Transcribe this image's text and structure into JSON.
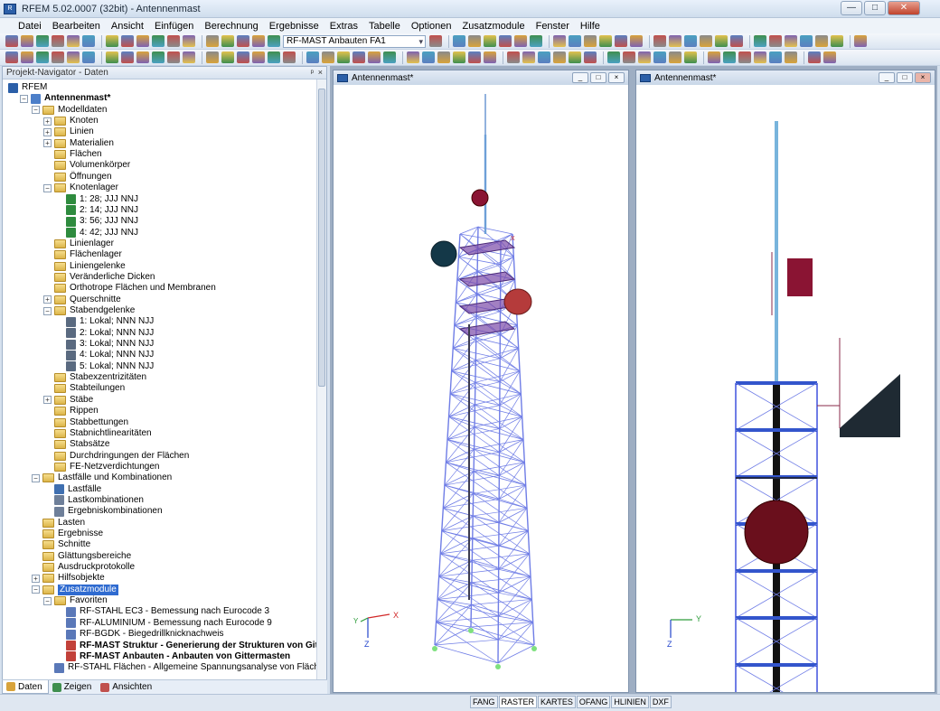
{
  "window": {
    "title": "RFEM 5.02.0007 (32bit) - Antennenmast",
    "min": "—",
    "max": "□",
    "close": "✕"
  },
  "menu": [
    "Datei",
    "Bearbeiten",
    "Ansicht",
    "Einfügen",
    "Berechnung",
    "Ergebnisse",
    "Extras",
    "Tabelle",
    "Optionen",
    "Zusatzmodule",
    "Fenster",
    "Hilfe"
  ],
  "toolbar": {
    "module_combo": "RF-MAST Anbauten FA1"
  },
  "navigator": {
    "title": "Projekt-Navigator - Daten",
    "pin": "ᵖ",
    "close": "×",
    "items": [
      {
        "t": "RFEM",
        "l": 0,
        "k": "root"
      },
      {
        "t": "Antennenmast*",
        "l": 1,
        "k": "proj",
        "b": true,
        "e": "-"
      },
      {
        "t": "Modelldaten",
        "l": 2,
        "k": "f",
        "e": "-"
      },
      {
        "t": "Knoten",
        "l": 3,
        "k": "f",
        "e": "+"
      },
      {
        "t": "Linien",
        "l": 3,
        "k": "f",
        "e": "+"
      },
      {
        "t": "Materialien",
        "l": 3,
        "k": "f",
        "e": "+"
      },
      {
        "t": "Flächen",
        "l": 3,
        "k": "f"
      },
      {
        "t": "Volumenkörper",
        "l": 3,
        "k": "f"
      },
      {
        "t": "Öffnungen",
        "l": 3,
        "k": "f"
      },
      {
        "t": "Knotenlager",
        "l": 3,
        "k": "f",
        "e": "-"
      },
      {
        "t": "1: 28; JJJ NNJ",
        "l": 4,
        "k": "sup"
      },
      {
        "t": "2: 14; JJJ NNJ",
        "l": 4,
        "k": "sup"
      },
      {
        "t": "3: 56; JJJ NNJ",
        "l": 4,
        "k": "sup"
      },
      {
        "t": "4: 42; JJJ NNJ",
        "l": 4,
        "k": "sup"
      },
      {
        "t": "Linienlager",
        "l": 3,
        "k": "f"
      },
      {
        "t": "Flächenlager",
        "l": 3,
        "k": "f"
      },
      {
        "t": "Liniengelenke",
        "l": 3,
        "k": "f"
      },
      {
        "t": "Veränderliche Dicken",
        "l": 3,
        "k": "f"
      },
      {
        "t": "Orthotrope Flächen und Membranen",
        "l": 3,
        "k": "f"
      },
      {
        "t": "Querschnitte",
        "l": 3,
        "k": "f",
        "e": "+"
      },
      {
        "t": "Stabendgelenke",
        "l": 3,
        "k": "f",
        "e": "-"
      },
      {
        "t": "1: Lokal; NNN NJJ",
        "l": 4,
        "k": "hinge"
      },
      {
        "t": "2: Lokal; NNN NJJ",
        "l": 4,
        "k": "hinge"
      },
      {
        "t": "3: Lokal; NNN NJJ",
        "l": 4,
        "k": "hinge"
      },
      {
        "t": "4: Lokal; NNN NJJ",
        "l": 4,
        "k": "hinge"
      },
      {
        "t": "5: Lokal; NNN NJJ",
        "l": 4,
        "k": "hinge"
      },
      {
        "t": "Stabexzentrizitäten",
        "l": 3,
        "k": "f"
      },
      {
        "t": "Stabteilungen",
        "l": 3,
        "k": "f"
      },
      {
        "t": "Stäbe",
        "l": 3,
        "k": "f",
        "e": "+"
      },
      {
        "t": "Rippen",
        "l": 3,
        "k": "f"
      },
      {
        "t": "Stabbettungen",
        "l": 3,
        "k": "f"
      },
      {
        "t": "Stabnichtlinearitäten",
        "l": 3,
        "k": "f"
      },
      {
        "t": "Stabsätze",
        "l": 3,
        "k": "f"
      },
      {
        "t": "Durchdringungen der Flächen",
        "l": 3,
        "k": "f"
      },
      {
        "t": "FE-Netzverdichtungen",
        "l": 3,
        "k": "f"
      },
      {
        "t": "Lastfälle und Kombinationen",
        "l": 2,
        "k": "f",
        "e": "-"
      },
      {
        "t": "Lastfälle",
        "l": 3,
        "k": "lf"
      },
      {
        "t": "Lastkombinationen",
        "l": 3,
        "k": "lk"
      },
      {
        "t": "Ergebniskombinationen",
        "l": 3,
        "k": "lk"
      },
      {
        "t": "Lasten",
        "l": 2,
        "k": "f"
      },
      {
        "t": "Ergebnisse",
        "l": 2,
        "k": "f"
      },
      {
        "t": "Schnitte",
        "l": 2,
        "k": "f"
      },
      {
        "t": "Glättungsbereiche",
        "l": 2,
        "k": "f"
      },
      {
        "t": "Ausdruckprotokolle",
        "l": 2,
        "k": "f"
      },
      {
        "t": "Hilfsobjekte",
        "l": 2,
        "k": "f",
        "e": "+"
      },
      {
        "t": "Zusatzmodule",
        "l": 2,
        "k": "f",
        "e": "-",
        "s": true
      },
      {
        "t": "Favoriten",
        "l": 3,
        "k": "f",
        "e": "-"
      },
      {
        "t": "RF-STAHL EC3 - Bemessung nach Eurocode 3",
        "l": 4,
        "k": "mod"
      },
      {
        "t": "RF-ALUMINIUM - Bemessung nach Eurocode 9",
        "l": 4,
        "k": "mod"
      },
      {
        "t": "RF-BGDK - Biegedrillknicknachweis",
        "l": 4,
        "k": "mod"
      },
      {
        "t": "RF-MAST Struktur - Generierung der Strukturen von Gittermasten",
        "l": 4,
        "k": "modr",
        "b": true
      },
      {
        "t": "RF-MAST Anbauten - Anbauten von Gittermasten",
        "l": 4,
        "k": "modr",
        "b": true
      },
      {
        "t": "RF-STAHL Flächen - Allgemeine Spannungsanalyse von Flächen",
        "l": 3,
        "k": "mod"
      }
    ]
  },
  "navtabs": [
    "Daten",
    "Zeigen",
    "Ansichten"
  ],
  "views": [
    {
      "title": "Antennenmast*",
      "axes": {
        "x": "X",
        "y": "Y",
        "z": "Z"
      }
    },
    {
      "title": "Antennenmast*",
      "axes": {
        "y": "Y",
        "z": "Z"
      }
    }
  ],
  "view_axis_mark": "X",
  "status": [
    "FANG",
    "RASTER",
    "KARTES",
    "OFANG",
    "HLINIEN",
    "DXF"
  ],
  "colors": {
    "accent": "#2f6bd0",
    "mast": "#6f7de6",
    "dish": "#8a1433"
  }
}
